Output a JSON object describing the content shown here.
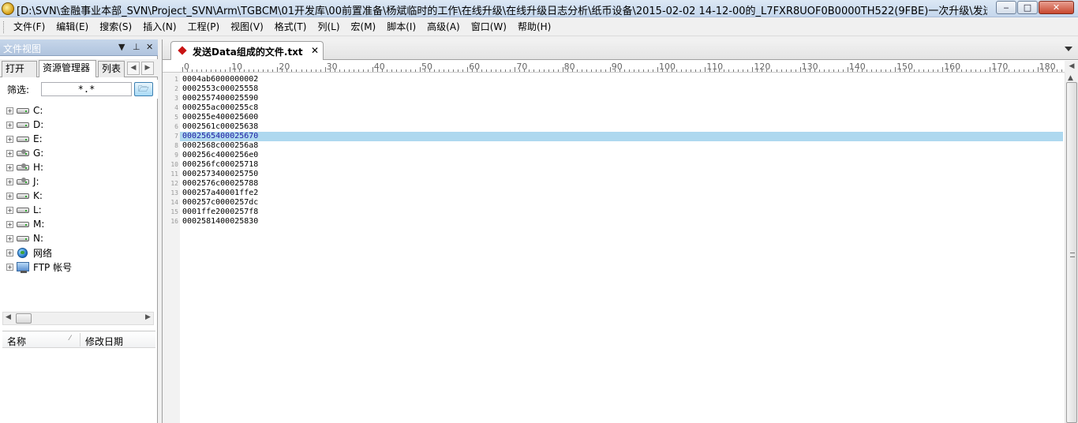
{
  "window": {
    "title": "[D:\\SVN\\金融事业本部_SVN\\Project_SVN\\Arm\\TGBCM\\01开发库\\00前置准备\\杨斌临时的工作\\在线升级\\在线升级日志分析\\纸币设备\\2015-02-02 14-12-00的_L7FXR8UOF0B0000TH522(9FBE)一次升级\\发送Data组成的文...",
    "minimize": "‒",
    "maximize": "□",
    "close": "✕"
  },
  "menu": [
    "文件(F)",
    "编辑(E)",
    "搜索(S)",
    "插入(N)",
    "工程(P)",
    "视图(V)",
    "格式(T)",
    "列(L)",
    "宏(M)",
    "脚本(I)",
    "高级(A)",
    "窗口(W)",
    "帮助(H)"
  ],
  "file_panel": {
    "title": "文件视图",
    "tabs": [
      "打开",
      "资源管理器",
      "列表"
    ],
    "filter_label": "筛选:",
    "filter_value": "*.*",
    "tree": [
      {
        "label": "C:",
        "icon": "drive-icon"
      },
      {
        "label": "D:",
        "icon": "drive-icon"
      },
      {
        "label": "E:",
        "icon": "drive-icon"
      },
      {
        "label": "G:",
        "icon": "network-drive-icon"
      },
      {
        "label": "H:",
        "icon": "network-drive-icon"
      },
      {
        "label": "J:",
        "icon": "network-drive-icon"
      },
      {
        "label": "K:",
        "icon": "drive-icon"
      },
      {
        "label": "L:",
        "icon": "drive-icon"
      },
      {
        "label": "M:",
        "icon": "drive-icon"
      },
      {
        "label": "N:",
        "icon": "drive-icon"
      },
      {
        "label": "网络",
        "icon": "network-globe-icon"
      },
      {
        "label": "FTP 帐号",
        "icon": "ftp-icon"
      }
    ],
    "columns": {
      "name": "名称",
      "modified": "修改日期"
    }
  },
  "editor": {
    "tab_name": "发送Data组成的文件.txt",
    "tab_close": "✕",
    "highlighted_line": 7,
    "lines": [
      "0004ab6000000002",
      "0002553c00025558",
      "0002557400025590",
      "000255ac000255c8",
      "000255e400025600",
      "0002561c00025638",
      "0002565400025670",
      "0002568c000256a8",
      "000256c4000256e0",
      "000256fc00025718",
      "0002573400025750",
      "0002576c00025788",
      "000257a40001ffe2",
      "000257c0000257dc",
      "0001ffe2000257f8",
      "0002581400025830"
    ],
    "ruler_labels": [
      "0",
      "10",
      "20",
      "30",
      "40",
      "50",
      "60",
      "70",
      "80",
      "90",
      "100",
      "110",
      "120",
      "130",
      "140",
      "150",
      "160",
      "170",
      "180"
    ]
  },
  "colors": {
    "highlight": "#aed8ef",
    "titlebar": "#c4d6ec",
    "tab_marker": "#c81414"
  }
}
